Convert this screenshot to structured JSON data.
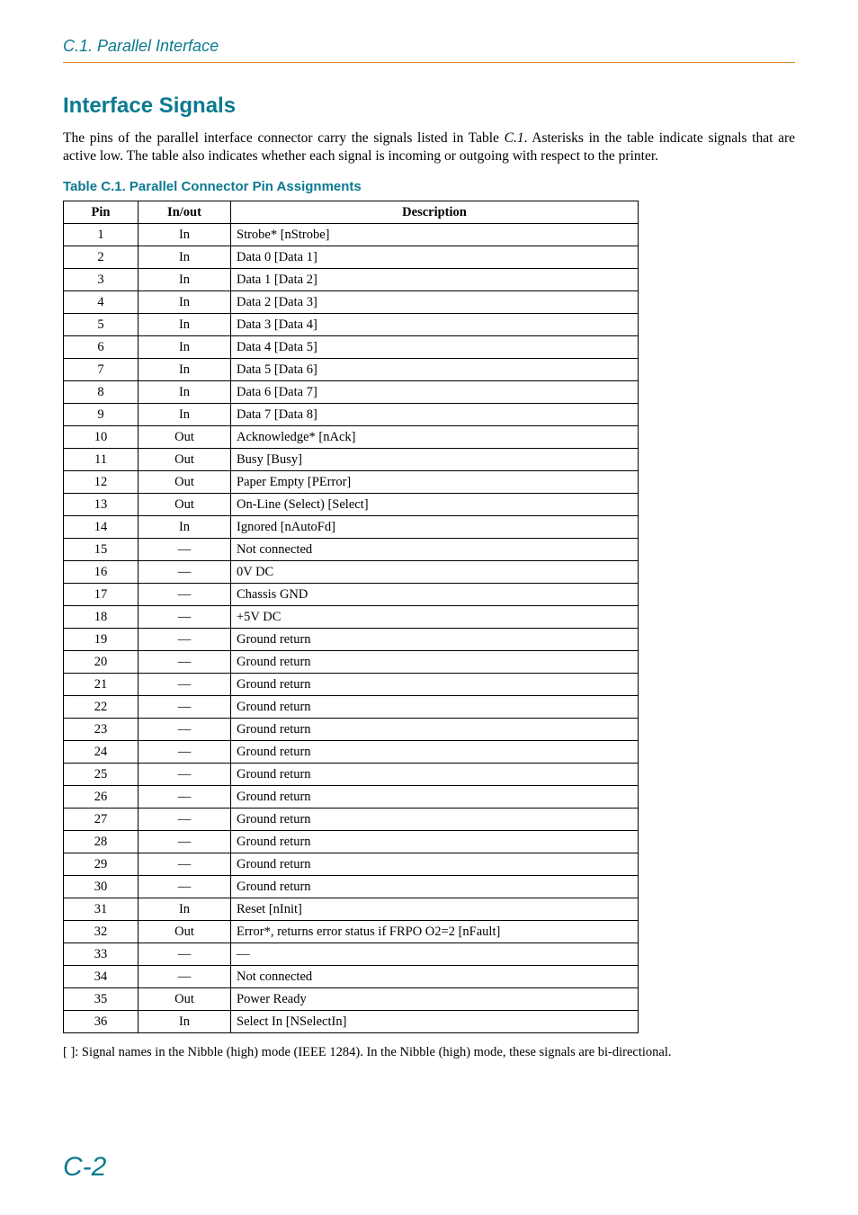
{
  "running_head": "C.1. Parallel Interface",
  "heading": "Interface Signals",
  "intro_pre_ref": "The pins of the parallel interface connector carry the signals listed in Table ",
  "intro_ref": "C.1",
  "intro_post_ref": ". Asterisks in the table indicate signals that are active low. The table also indicates whether each signal is incoming or outgoing with respect to the printer.",
  "caption": "Table C.1.  Parallel Connector Pin Assignments",
  "columns": {
    "pin": "Pin",
    "io": "In/out",
    "desc": "Description"
  },
  "rows": [
    {
      "pin": "1",
      "io": "In",
      "desc": "Strobe* [nStrobe]"
    },
    {
      "pin": "2",
      "io": "In",
      "desc": "Data 0 [Data 1]"
    },
    {
      "pin": "3",
      "io": "In",
      "desc": "Data 1 [Data 2]"
    },
    {
      "pin": "4",
      "io": "In",
      "desc": "Data 2 [Data 3]"
    },
    {
      "pin": "5",
      "io": "In",
      "desc": "Data 3 [Data 4]"
    },
    {
      "pin": "6",
      "io": "In",
      "desc": "Data 4 [Data 5]"
    },
    {
      "pin": "7",
      "io": "In",
      "desc": "Data 5 [Data 6]"
    },
    {
      "pin": "8",
      "io": "In",
      "desc": "Data 6 [Data 7]"
    },
    {
      "pin": "9",
      "io": "In",
      "desc": "Data 7 [Data 8]"
    },
    {
      "pin": "10",
      "io": "Out",
      "desc": "Acknowledge* [nAck]"
    },
    {
      "pin": "11",
      "io": "Out",
      "desc": "Busy [Busy]"
    },
    {
      "pin": "12",
      "io": "Out",
      "desc": "Paper Empty [PError]"
    },
    {
      "pin": "13",
      "io": "Out",
      "desc": "On-Line (Select) [Select]"
    },
    {
      "pin": "14",
      "io": "In",
      "desc": "Ignored [nAutoFd]"
    },
    {
      "pin": "15",
      "io": "—",
      "desc": "Not connected"
    },
    {
      "pin": "16",
      "io": "—",
      "desc": "0V DC"
    },
    {
      "pin": "17",
      "io": "—",
      "desc": "Chassis GND"
    },
    {
      "pin": "18",
      "io": "—",
      "desc": "+5V DC"
    },
    {
      "pin": "19",
      "io": "—",
      "desc": "Ground return"
    },
    {
      "pin": "20",
      "io": "—",
      "desc": "Ground return"
    },
    {
      "pin": "21",
      "io": "—",
      "desc": "Ground return"
    },
    {
      "pin": "22",
      "io": "—",
      "desc": "Ground return"
    },
    {
      "pin": "23",
      "io": "—",
      "desc": "Ground return"
    },
    {
      "pin": "24",
      "io": "—",
      "desc": "Ground return"
    },
    {
      "pin": "25",
      "io": "—",
      "desc": "Ground return"
    },
    {
      "pin": "26",
      "io": "—",
      "desc": "Ground return"
    },
    {
      "pin": "27",
      "io": "—",
      "desc": "Ground return"
    },
    {
      "pin": "28",
      "io": "—",
      "desc": "Ground return"
    },
    {
      "pin": "29",
      "io": "—",
      "desc": "Ground return"
    },
    {
      "pin": "30",
      "io": "—",
      "desc": "Ground return"
    },
    {
      "pin": "31",
      "io": "In",
      "desc": "Reset [nInit]"
    },
    {
      "pin": "32",
      "io": "Out",
      "desc": "Error*, returns error status if FRPO O2=2 [nFault]"
    },
    {
      "pin": "33",
      "io": "—",
      "desc": "—"
    },
    {
      "pin": "34",
      "io": "—",
      "desc": "Not connected"
    },
    {
      "pin": "35",
      "io": "Out",
      "desc": "Power Ready"
    },
    {
      "pin": "36",
      "io": "In",
      "desc": "Select In [NSelectIn]"
    }
  ],
  "footnote": "[    ]: Signal names in the Nibble (high) mode (IEEE 1284).  In the Nibble (high) mode, these signals are bi-directional.",
  "page_number": "C-2"
}
